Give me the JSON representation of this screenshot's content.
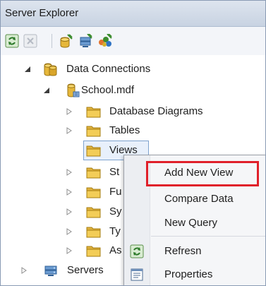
{
  "panel": {
    "title": "Server Explorer"
  },
  "toolbar": {
    "buttons": [
      {
        "icon": "refresh-icon"
      },
      {
        "icon": "stop-icon"
      },
      {
        "icon": "connect-to-database-icon"
      },
      {
        "icon": "connect-to-server-icon"
      },
      {
        "icon": "connect-to-sharepoint-icon"
      }
    ]
  },
  "tree": {
    "data_connections": "Data Connections",
    "school": "School.mdf",
    "database_diagrams": "Database Diagrams",
    "tables": "Tables",
    "views": "Views",
    "stored_procedures": "St",
    "functions": "Fu",
    "synonyms": "Sy",
    "types": "Ty",
    "assemblies": "As",
    "servers": "Servers"
  },
  "context_menu": {
    "add_new_view": "Add New View",
    "compare_data": "Compare Data",
    "new_query": "New Query",
    "refresh": "Refresn",
    "properties": "Properties"
  },
  "colors": {
    "highlight_border": "#e0202a",
    "selection_border": "#7da2ce",
    "folder_yellow": "#f3cd57"
  }
}
